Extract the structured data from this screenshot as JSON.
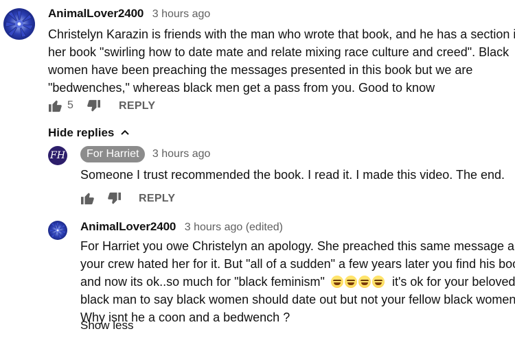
{
  "comment": {
    "author": "AnimalLover2400",
    "time": "3 hours ago",
    "lines": [
      "Christelyn Karazin is friends with the man who wrote that book, and he has a section in",
      "her book \"swirling how to date mate and relate mixing race culture and creed\". Black",
      "women have been preaching the messages presented in this book but we are",
      "\"bedwenches,\" whereas black men get a pass from you. Good to know"
    ],
    "like_count": "5",
    "reply_label": "REPLY",
    "avatar_icon": "cornflower-avatar"
  },
  "hide_replies_label": "Hide replies",
  "replies": [
    {
      "author": "For Harriet",
      "time": "3 hours ago",
      "text": "Someone I trust recommended the book. I read it. I made this video. The end.",
      "reply_label": "REPLY",
      "avatar_initials": "FH"
    },
    {
      "author": "AnimalLover2400",
      "time": "3 hours ago (edited)",
      "lines": [
        "For Harriet you owe Christelyn an apology. She preached this same message and",
        "your crew hated her for it. But \"all of a sudden\" a few years later you find his book",
        "and now its ok..so much for \"black feminism\"",
        "it's ok for your beloved",
        "black man to say black women should date out but not your fellow black women.",
        "Why isnt he a coon and a bedwench ?"
      ],
      "emoji": "😂😂😂😂",
      "show_less_label": "Show less",
      "avatar_icon": "cornflower-avatar"
    }
  ],
  "colors": {
    "text": "#111111",
    "secondary": "#606060",
    "owner_badge": "#8c8c8c",
    "fh_avatar": "#2d1e6b"
  }
}
